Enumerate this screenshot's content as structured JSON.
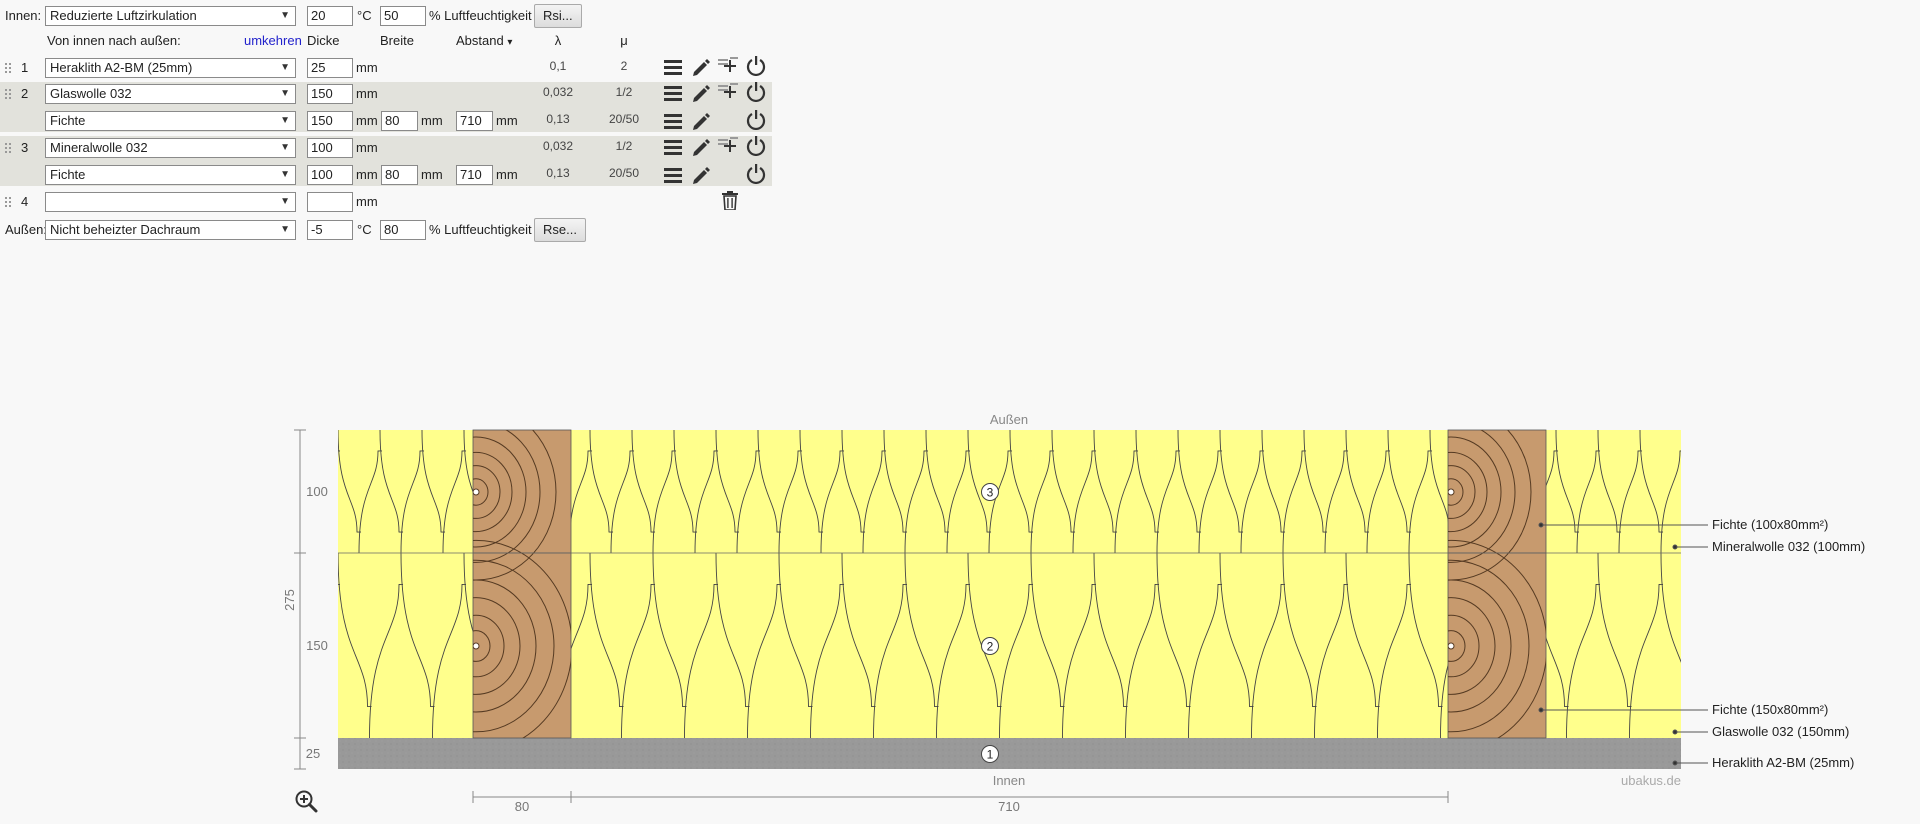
{
  "inner": {
    "label": "Innen:",
    "climate": "Reduzierte Luftzirkulation",
    "temp": "20",
    "temp_unit": "°C",
    "humidity": "50",
    "humidity_unit": "% Luftfeuchtigkeit",
    "rsi_button": "Rsi..."
  },
  "header": {
    "direction": "Von innen nach außen:",
    "reverse": "umkehren",
    "thickness": "Dicke",
    "width": "Breite",
    "spacing": "Abstand",
    "spacing_arrow": "▾",
    "lambda": "λ",
    "mu": "μ"
  },
  "layers": [
    {
      "num": "1",
      "material": "Heraklith A2-BM (25mm)",
      "thickness": "25",
      "unit": "mm",
      "lambda": "0,1",
      "mu": "2"
    },
    {
      "num": "2",
      "material": "Glaswolle 032",
      "thickness": "150",
      "unit": "mm",
      "lambda": "0,032",
      "mu": "1/2",
      "beam": {
        "material": "Fichte",
        "thickness": "150",
        "width": "80",
        "spacing": "710",
        "unit": "mm",
        "lambda": "0,13",
        "mu": "20/50"
      }
    },
    {
      "num": "3",
      "material": "Mineralwolle 032",
      "thickness": "100",
      "unit": "mm",
      "lambda": "0,032",
      "mu": "1/2",
      "beam": {
        "material": "Fichte",
        "thickness": "100",
        "width": "80",
        "spacing": "710",
        "unit": "mm",
        "lambda": "0,13",
        "mu": "20/50"
      }
    },
    {
      "num": "4",
      "material": "",
      "thickness": "",
      "unit": "mm"
    }
  ],
  "outer": {
    "label": "Außen:",
    "climate": "Nicht beheizter Dachraum",
    "temp": "-5",
    "temp_unit": "°C",
    "humidity": "80",
    "humidity_unit": "% Luftfeuchtigkeit",
    "rse_button": "Rse..."
  },
  "drawing": {
    "top_label": "Außen",
    "bottom_label": "Innen",
    "watermark": "ubakus.de",
    "dim_left": [
      "100",
      "150",
      "25"
    ],
    "dim_total": "275",
    "dim_bottom": [
      "80",
      "710"
    ],
    "layer_markers": [
      "1",
      "2",
      "3"
    ],
    "legend": [
      "Fichte (100x80mm²)",
      "Mineralwolle 032 (100mm)",
      "Fichte (150x80mm²)",
      "Glaswolle 032 (150mm)",
      "Heraklith A2-BM (25mm)"
    ],
    "colors": {
      "insulation": "#ffff8c",
      "wood": "#c79a6e",
      "heraklith": "#999999",
      "background": "#f8f8f8"
    }
  }
}
